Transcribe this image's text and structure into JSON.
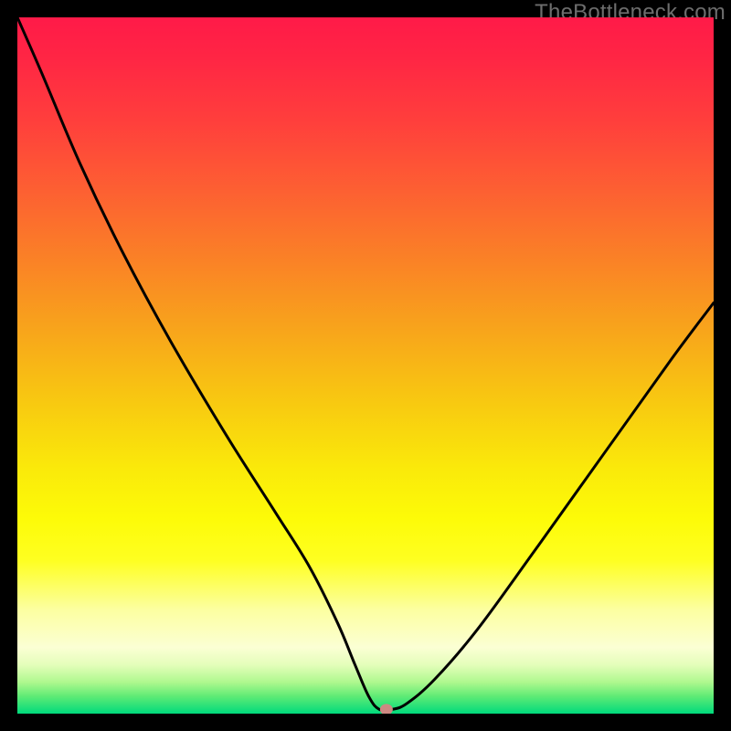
{
  "watermark": "TheBottleneck.com",
  "colors": {
    "frame_border": "#000000",
    "curve_stroke": "#000000",
    "marker_fill": "#cd8982"
  },
  "gradient_stops": [
    {
      "offset": 0.0,
      "color": "#ff1a48"
    },
    {
      "offset": 0.06,
      "color": "#ff2644"
    },
    {
      "offset": 0.15,
      "color": "#ff3f3c"
    },
    {
      "offset": 0.25,
      "color": "#fd6032"
    },
    {
      "offset": 0.35,
      "color": "#fa8226"
    },
    {
      "offset": 0.45,
      "color": "#f8a51b"
    },
    {
      "offset": 0.55,
      "color": "#f8c811"
    },
    {
      "offset": 0.65,
      "color": "#faea0a"
    },
    {
      "offset": 0.72,
      "color": "#fdfb08"
    },
    {
      "offset": 0.78,
      "color": "#feff21"
    },
    {
      "offset": 0.85,
      "color": "#fcffa0"
    },
    {
      "offset": 0.905,
      "color": "#fbffd4"
    },
    {
      "offset": 0.93,
      "color": "#e4feba"
    },
    {
      "offset": 0.955,
      "color": "#aef88e"
    },
    {
      "offset": 0.975,
      "color": "#5feb75"
    },
    {
      "offset": 1.0,
      "color": "#00da7c"
    }
  ],
  "chart_data": {
    "type": "line",
    "title": "",
    "xlabel": "",
    "ylabel": "",
    "xlim": [
      0,
      100
    ],
    "ylim": [
      0,
      100
    ],
    "series": [
      {
        "name": "bottleneck-curve",
        "x": [
          0,
          3.5,
          9,
          15,
          22,
          30,
          37,
          42,
          46,
          48.5,
          50.5,
          52,
          53.8,
          56,
          60,
          66,
          74,
          84,
          94,
          100
        ],
        "y": [
          100,
          92,
          79,
          66.5,
          53.5,
          40,
          29,
          21,
          13,
          7,
          2.4,
          0.6,
          0.6,
          1.5,
          5,
          12,
          23,
          37,
          51,
          59
        ]
      }
    ],
    "marker": {
      "x": 53,
      "y": 0.6
    }
  }
}
